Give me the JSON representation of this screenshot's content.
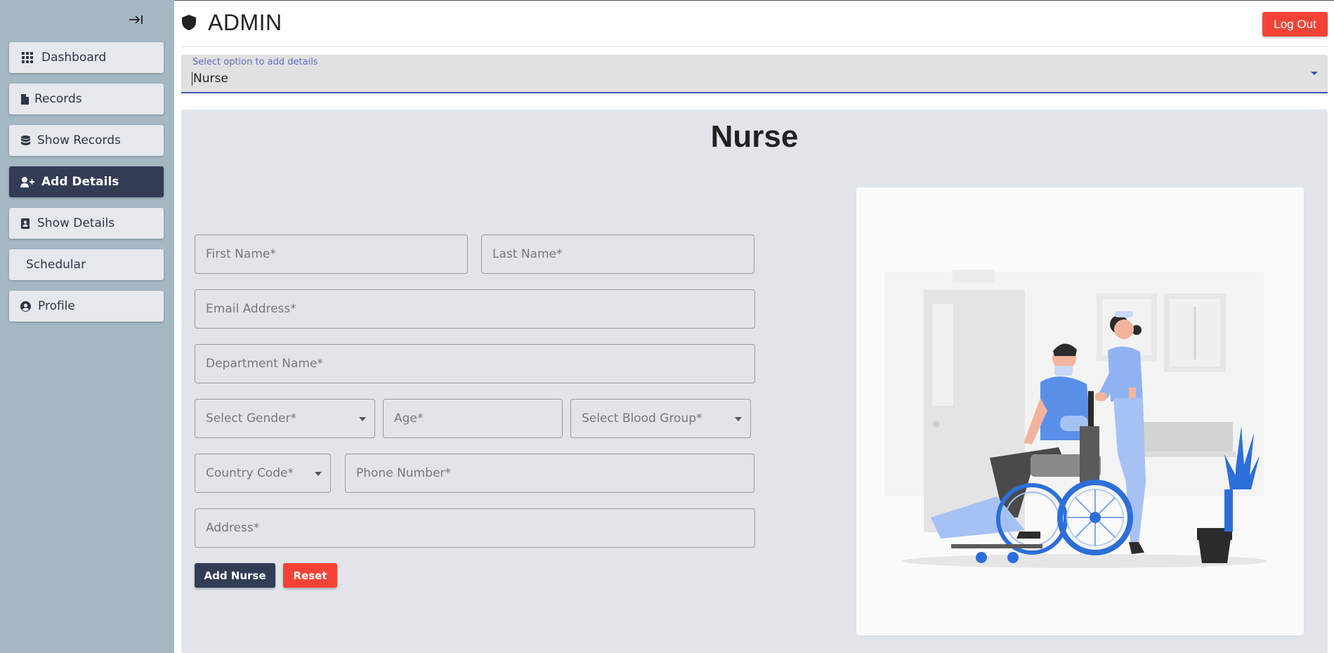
{
  "sidebar": {
    "items": [
      {
        "label": "Dashboard",
        "icon": "grid-icon"
      },
      {
        "label": "Records",
        "icon": "file-icon"
      },
      {
        "label": "Show Records",
        "icon": "database-icon"
      },
      {
        "label": "Add Details",
        "icon": "user-plus-icon",
        "active": true
      },
      {
        "label": "Show Details",
        "icon": "contact-card-icon"
      },
      {
        "label": "Schedular",
        "icon": ""
      },
      {
        "label": "Profile",
        "icon": "user-circle-icon"
      }
    ]
  },
  "header": {
    "title": "ADMIN",
    "logout_label": "Log Out"
  },
  "option_select": {
    "label": "Select option to add details",
    "value": "Nurse"
  },
  "form": {
    "title": "Nurse",
    "first_name": "First Name*",
    "last_name": "Last Name*",
    "email": "Email Address*",
    "department": "Department Name*",
    "gender": "Select Gender*",
    "age": "Age*",
    "blood_group": "Select Blood Group*",
    "country_code": "Country Code*",
    "phone": "Phone Number*",
    "address": "Address*",
    "submit_label": "Add Nurse",
    "reset_label": "Reset"
  },
  "colors": {
    "sidebar_bg": "#a4b8c4",
    "active_nav": "#323c55",
    "danger": "#f44336",
    "accent": "#3f51b5",
    "card_bg": "#e1e5ea"
  }
}
